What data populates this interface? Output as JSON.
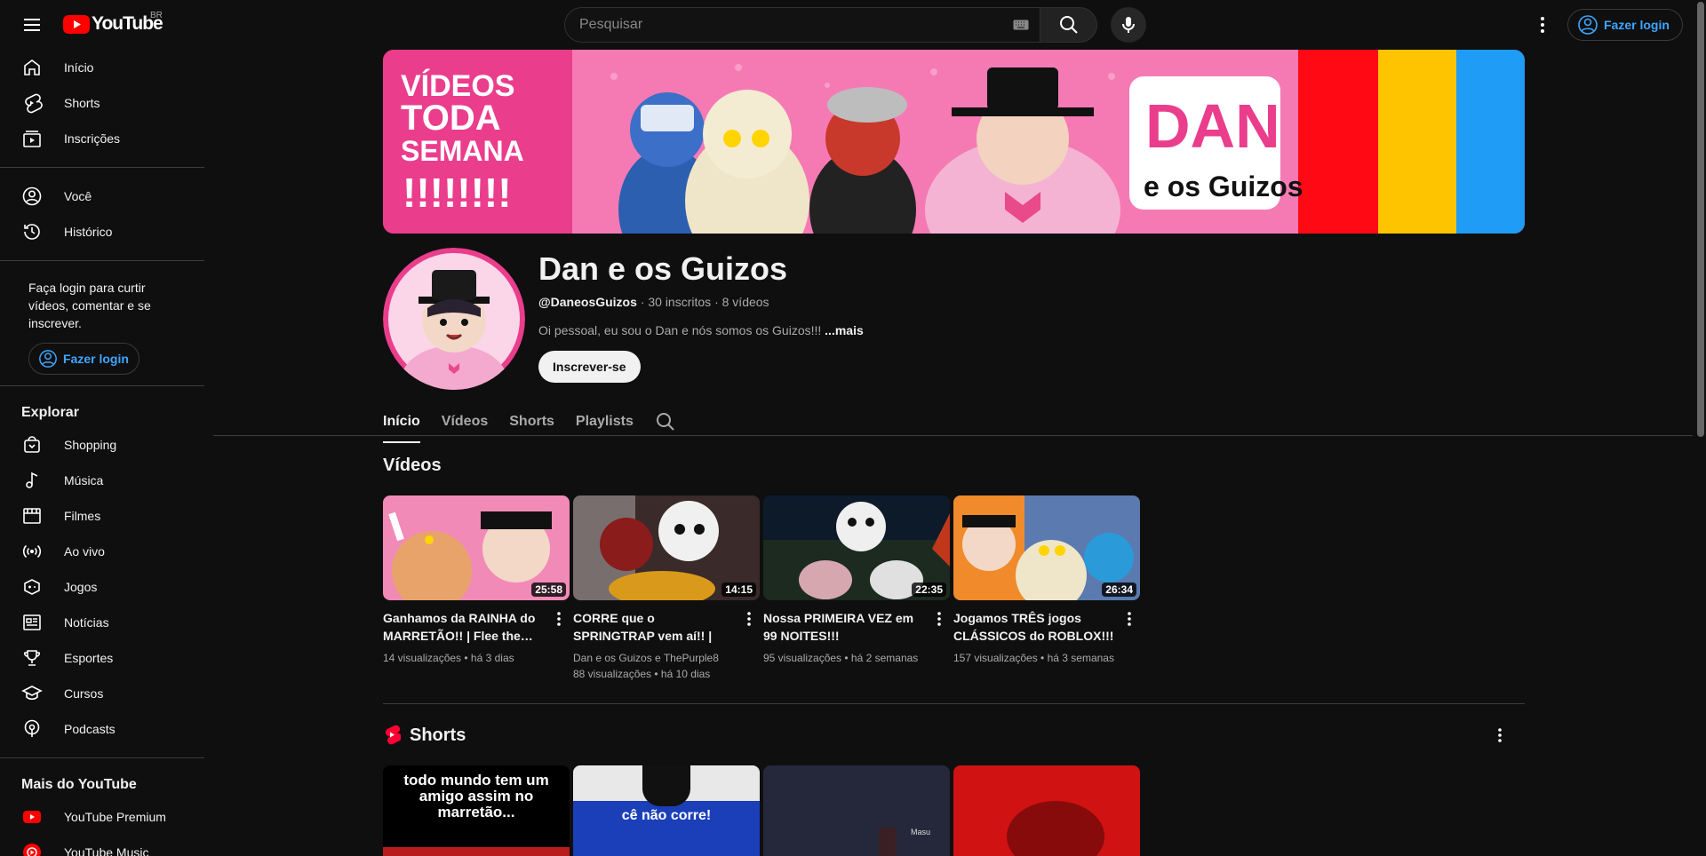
{
  "header": {
    "logo_text": "YouTube",
    "region": "BR",
    "search_placeholder": "Pesquisar",
    "signin_label": "Fazer login"
  },
  "sidebar": {
    "primary": [
      {
        "label": "Início",
        "icon": "home-icon"
      },
      {
        "label": "Shorts",
        "icon": "shorts-icon"
      },
      {
        "label": "Inscrições",
        "icon": "subscriptions-icon"
      }
    ],
    "secondary": [
      {
        "label": "Você",
        "icon": "user-icon"
      },
      {
        "label": "Histórico",
        "icon": "history-icon"
      }
    ],
    "login_prompt": "Faça login para curtir vídeos, comentar e se inscrever.",
    "login_button": "Fazer login",
    "explore_heading": "Explorar",
    "explore": [
      {
        "label": "Shopping",
        "icon": "shopping-bag-icon"
      },
      {
        "label": "Música",
        "icon": "music-note-icon"
      },
      {
        "label": "Filmes",
        "icon": "film-icon"
      },
      {
        "label": "Ao vivo",
        "icon": "live-icon"
      },
      {
        "label": "Jogos",
        "icon": "gamepad-icon"
      },
      {
        "label": "Notícias",
        "icon": "news-icon"
      },
      {
        "label": "Esportes",
        "icon": "trophy-icon"
      },
      {
        "label": "Cursos",
        "icon": "graduation-cap-icon"
      },
      {
        "label": "Podcasts",
        "icon": "podcast-icon"
      }
    ],
    "more_heading": "Mais do YouTube",
    "more": [
      {
        "label": "YouTube Premium",
        "icon": "youtube-premium-icon"
      },
      {
        "label": "YouTube Music",
        "icon": "youtube-music-icon"
      }
    ]
  },
  "channel": {
    "banner_text": [
      "VÍDEOS",
      "TODA",
      "SEMANA",
      "!!!!!!!!"
    ],
    "banner_logo": "DAN",
    "banner_logo_sub": "e os Guizos",
    "name": "Dan e os Guizos",
    "handle": "@DaneosGuizos",
    "subscribers": "30 inscritos",
    "video_count": "8 vídeos",
    "description": "Oi pessoal, eu sou o Dan e nós somos os Guizos!!!",
    "description_more": "...mais",
    "subscribe_label": "Inscrever-se"
  },
  "tabs": [
    "Início",
    "Vídeos",
    "Shorts",
    "Playlists"
  ],
  "videos_section": {
    "title": "Vídeos",
    "items": [
      {
        "title": "Ganhamos da RAINHA do MARRETÃO!! | Flee the…",
        "duration": "25:58",
        "channel": "",
        "meta": "14 visualizações • há 3 dias",
        "color": "#f28ab8"
      },
      {
        "title": "CORRE que o SPRINGTRAP vem aí!! | FORSAKEN",
        "duration": "14:15",
        "channel": "Dan e os Guizos e ThePurple8",
        "meta": "88 visualizações • há 10 dias",
        "color": "#3a2a2a"
      },
      {
        "title": "Nossa PRIMEIRA VEZ em 99 NOITES!!!",
        "duration": "22:35",
        "channel": "",
        "meta": "95 visualizações • há 2 semanas",
        "color": "#2a3a2a"
      },
      {
        "title": "Jogamos TRÊS jogos CLÁSSICOS do ROBLOX!!! (…",
        "duration": "26:34",
        "channel": "",
        "meta": "157 visualizações • há 3 semanas",
        "color": "#5a7ab0"
      }
    ]
  },
  "shorts_section": {
    "title": "Shorts",
    "items": [
      {
        "caption": "todo mundo tem um amigo assim no marretão...",
        "color": "#000000"
      },
      {
        "caption": "cê não corre!",
        "color": "#1b3fb8"
      },
      {
        "caption": "Masu",
        "color": "#24283a"
      },
      {
        "caption": "",
        "color": "#d11212"
      }
    ]
  }
}
